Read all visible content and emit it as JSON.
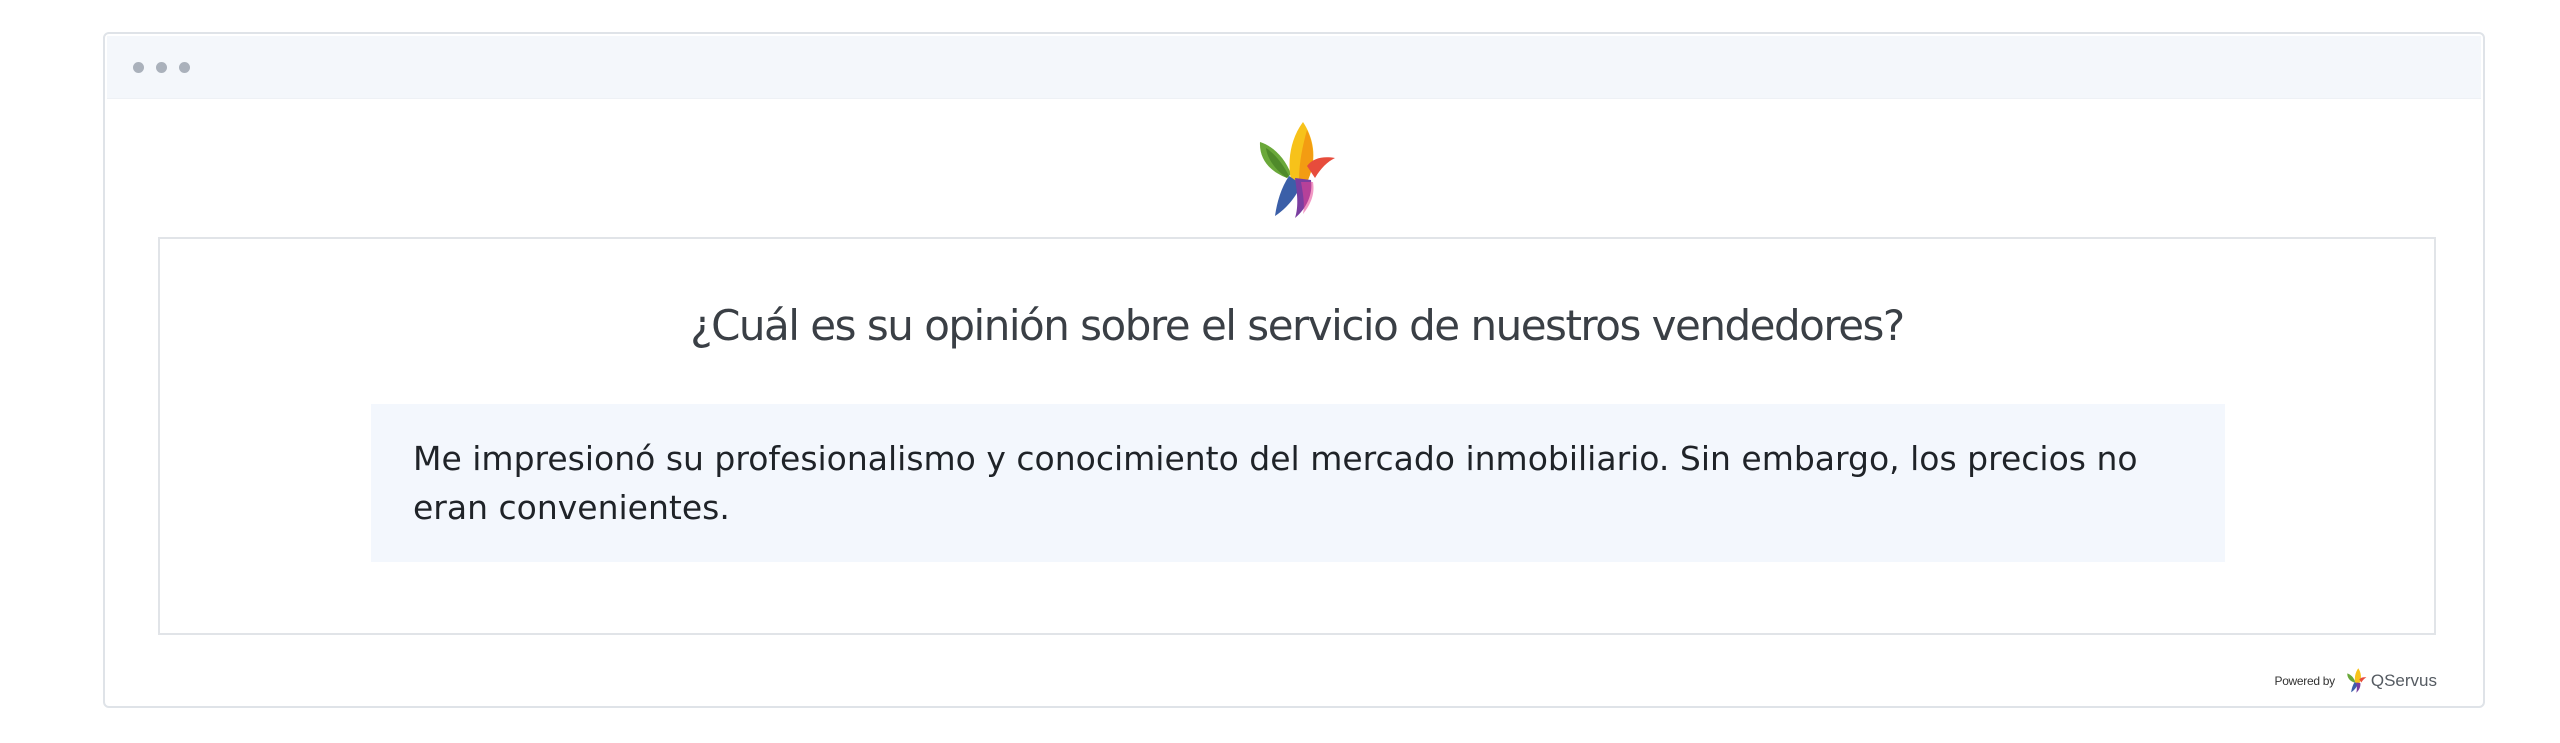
{
  "window": {
    "controls": [
      "dot",
      "dot",
      "dot"
    ]
  },
  "logo": {
    "icon": "hummingbird-logo-icon",
    "colors": [
      "#6aa83a",
      "#f7c21a",
      "#f39c12",
      "#e74c3c",
      "#3b5fa8",
      "#7a3ea0"
    ]
  },
  "question": {
    "text": "¿Cuál es su opinión sobre el servicio de nuestros vendedores?"
  },
  "answer": {
    "text": "Me impresionó su profesionalismo y conocimiento del mercado inmobiliario. Sin embargo, los precios no eran convenientes."
  },
  "footer": {
    "powered_by": "Powered by",
    "brand": "QServus"
  }
}
